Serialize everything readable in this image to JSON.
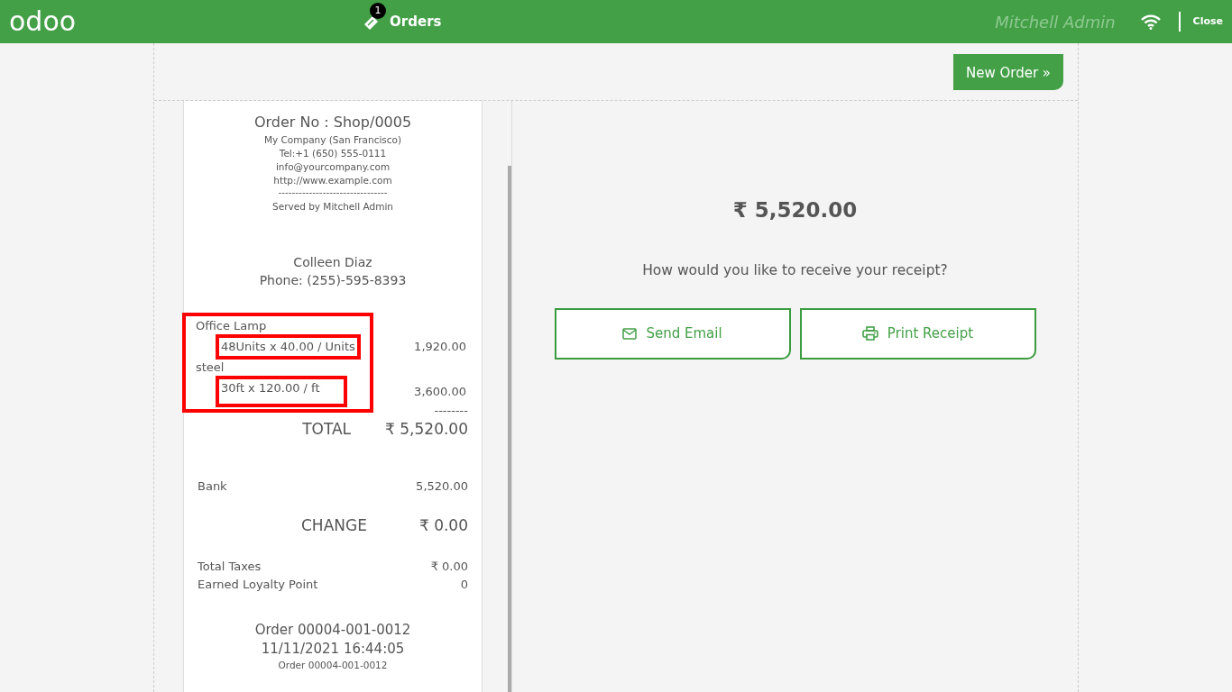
{
  "header": {
    "logo": "odoo",
    "orders_count": "1",
    "orders_label": "Orders",
    "user": "Mitchell Admin",
    "close": "Close"
  },
  "new_order_button": "New Order »",
  "receipt": {
    "order_no": "Order No : Shop/0005",
    "company_lines": [
      "My Company (San Francisco)",
      "Tel:+1 (650) 555-0111",
      "info@yourcompany.com",
      "http://www.example.com"
    ],
    "separator": "--------------------------------",
    "served_by": "Served by Mitchell Admin",
    "customer_lines": [
      "Colleen Diaz",
      "Phone: (255)-595-8393"
    ],
    "items_highlighted": true,
    "items": [
      {
        "name": "Office Lamp",
        "qty_line": "48Units x 40.00 / Units",
        "price": "1,920.00",
        "highlighted": true
      },
      {
        "name": "steel",
        "qty_line": "30ft x 120.00 / ft",
        "price": "3,600.00",
        "highlighted": true
      }
    ],
    "subtotal_separator": "--------",
    "total_label": "TOTAL",
    "total_value": "₹ 5,520.00",
    "payments": [
      {
        "method": "Bank",
        "amount": "5,520.00"
      }
    ],
    "change_label": "CHANGE",
    "change_value": "₹ 0.00",
    "extra_rows": [
      {
        "label": "Total Taxes",
        "value": "₹ 0.00"
      },
      {
        "label": "Earned Loyalty Point",
        "value": "0"
      }
    ],
    "footer_lines": [
      "Order 00004-001-0012",
      "11/11/2021 16:44:05"
    ],
    "footer_small": "Order 00004-001-0012"
  },
  "amount": "₹ 5,520.00",
  "question": "How would you like to receive your receipt?",
  "actions": [
    {
      "kind": "email",
      "label": "Send Email"
    },
    {
      "kind": "print",
      "label": "Print Receipt"
    }
  ]
}
